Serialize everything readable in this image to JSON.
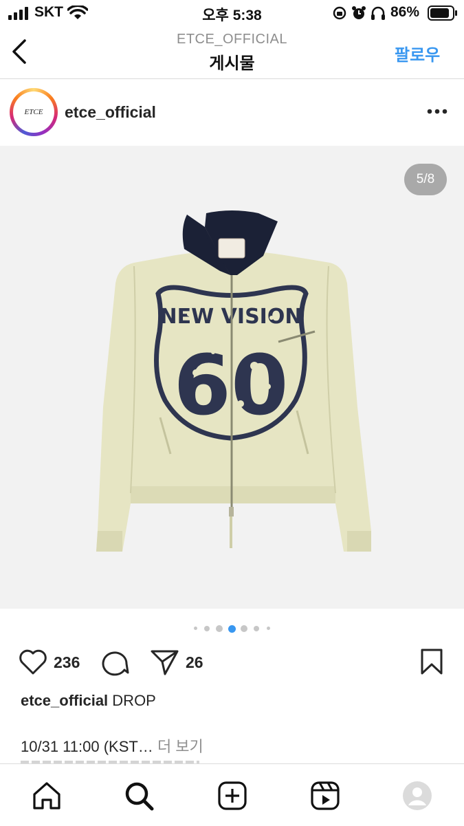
{
  "status_bar": {
    "carrier": "SKT",
    "time": "오후 5:38",
    "battery_percent": "86%"
  },
  "header": {
    "account": "ETCE_OFFICIAL",
    "title": "게시물",
    "follow_label": "팔로우"
  },
  "post": {
    "username": "etce_official",
    "avatar_text": "ETCE",
    "image_counter": "5/8",
    "current_image_fraction": 0.625,
    "carousel_dots": 7,
    "active_dot": 3,
    "likes": "236",
    "shares": "26",
    "caption_user": "etce_official",
    "caption_text": "DROP",
    "caption_line2": "10/31 11:00 (KST…",
    "more_label": "더 보기",
    "jacket_print_top": "NEW VISION",
    "jacket_print_num": "60"
  },
  "colors": {
    "accent": "#3897f0",
    "active_dot": "#3897f0",
    "jacket": "#e6e5c3",
    "collar": "#1b2136",
    "print": "#2e3550"
  }
}
